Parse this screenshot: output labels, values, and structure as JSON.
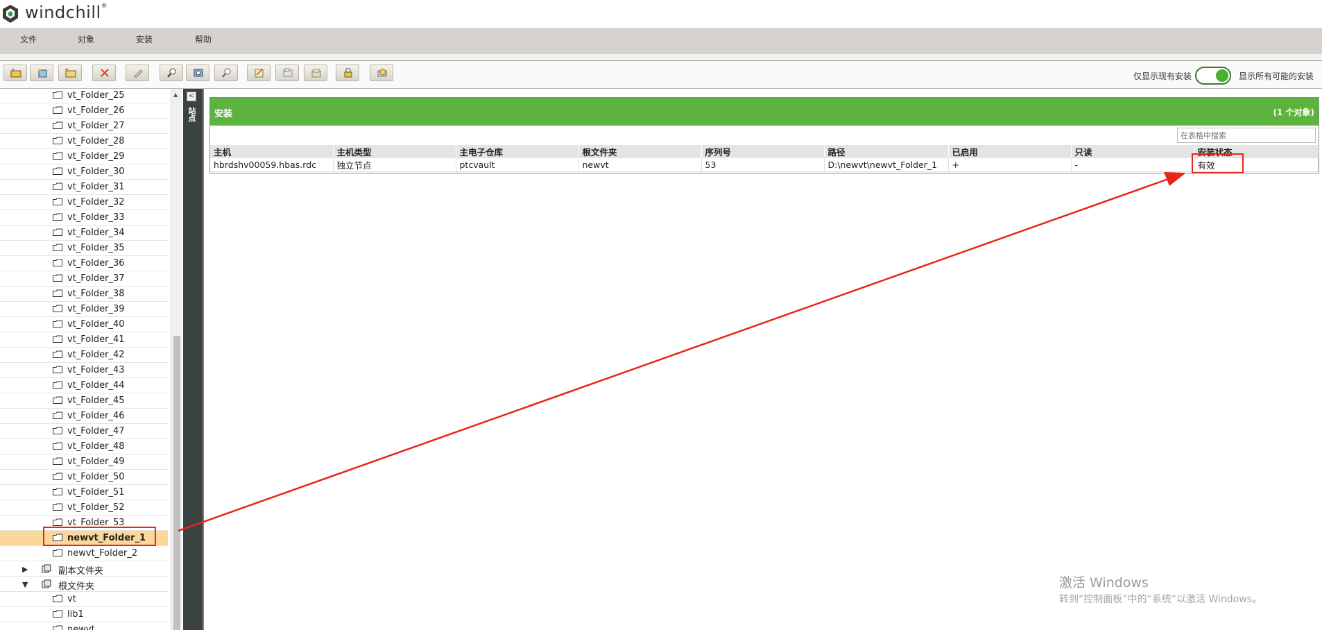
{
  "app": {
    "logo_text": "windchill"
  },
  "menu": {
    "items": [
      "文件",
      "对象",
      "安装",
      "帮助"
    ]
  },
  "toolbar": {
    "buttons": [
      "new-folder-icon",
      "new-item-icon",
      "new-subfolder-icon",
      "delete-icon",
      "edit-icon",
      "find-icon",
      "view-icon",
      "search-icon",
      "notes-icon",
      "move-icon",
      "copy-icon",
      "lock-icon",
      "mount-icon"
    ],
    "toggle_left_label": "仅显示现有安装",
    "toggle_right_label": "显示所有可能的安装",
    "toggle_on": true
  },
  "tree": {
    "folders": [
      "vt_Folder_25",
      "vt_Folder_26",
      "vt_Folder_27",
      "vt_Folder_28",
      "vt_Folder_29",
      "vt_Folder_30",
      "vt_Folder_31",
      "vt_Folder_32",
      "vt_Folder_33",
      "vt_Folder_34",
      "vt_Folder_35",
      "vt_Folder_36",
      "vt_Folder_37",
      "vt_Folder_38",
      "vt_Folder_39",
      "vt_Folder_40",
      "vt_Folder_41",
      "vt_Folder_42",
      "vt_Folder_43",
      "vt_Folder_44",
      "vt_Folder_45",
      "vt_Folder_46",
      "vt_Folder_47",
      "vt_Folder_48",
      "vt_Folder_49",
      "vt_Folder_50",
      "vt_Folder_51",
      "vt_Folder_52",
      "vt_Folder_53"
    ],
    "selected": "newvt_Folder_1",
    "after_selected": "newvt_Folder_2",
    "replica_label": "副本文件夹",
    "root_label": "根文件夹",
    "root_children": [
      "vt",
      "lib1",
      "newvt"
    ]
  },
  "strip": {
    "label": "站点"
  },
  "panel": {
    "title": "安装",
    "count": "(1 个对象)",
    "search_placeholder": "在表格中搜索",
    "columns": [
      "主机",
      "主机类型",
      "主电子仓库",
      "根文件夹",
      "序列号",
      "路径",
      "已启用",
      "只读",
      "安装状态"
    ],
    "rows": [
      [
        "hbrdshv00059.hbas.rdc",
        "独立节点",
        "ptcvault",
        "newvt",
        "53",
        "D:\\newvt\\newvt_Folder_1",
        "+",
        "-",
        "有效"
      ]
    ]
  },
  "watermark": {
    "title": "激活 Windows",
    "sub": "转到“控制面板”中的“系统”以激活 Windows。"
  },
  "colors": {
    "accent_green": "#5cb33e",
    "annotation_red": "#e8251a",
    "selected_row": "#fbd89a"
  }
}
